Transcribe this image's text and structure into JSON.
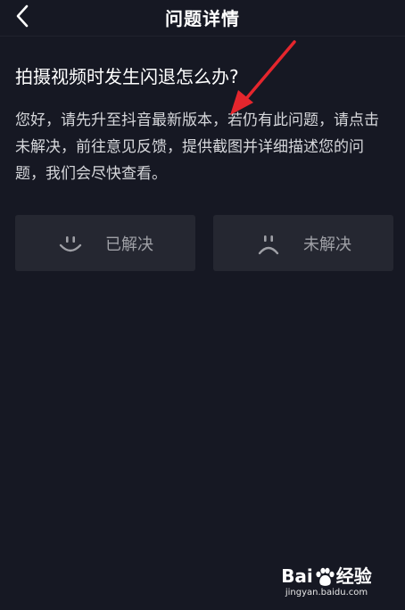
{
  "header": {
    "title": "问题详情"
  },
  "content": {
    "question": "拍摄视频时发生闪退怎么办?",
    "answer": "您好，请先升至抖音最新版本，若仍有此问题，请点击未解决，前往意见反馈，提供截图并详细描述您的问题，我们会尽快查看。"
  },
  "feedback": {
    "solved_label": "已解决",
    "unsolved_label": "未解决"
  },
  "watermark": {
    "logo_left": "Bai",
    "logo_right": "经验",
    "url": "jingyan.baidu.com"
  },
  "colors": {
    "background": "#161823",
    "button_bg": "#252731",
    "button_text": "#9fa0a6",
    "annotation_arrow": "#e5262d"
  },
  "icons": {
    "back": "chevron-left-icon",
    "solved": "smile-face-icon",
    "unsolved": "frown-face-icon"
  }
}
